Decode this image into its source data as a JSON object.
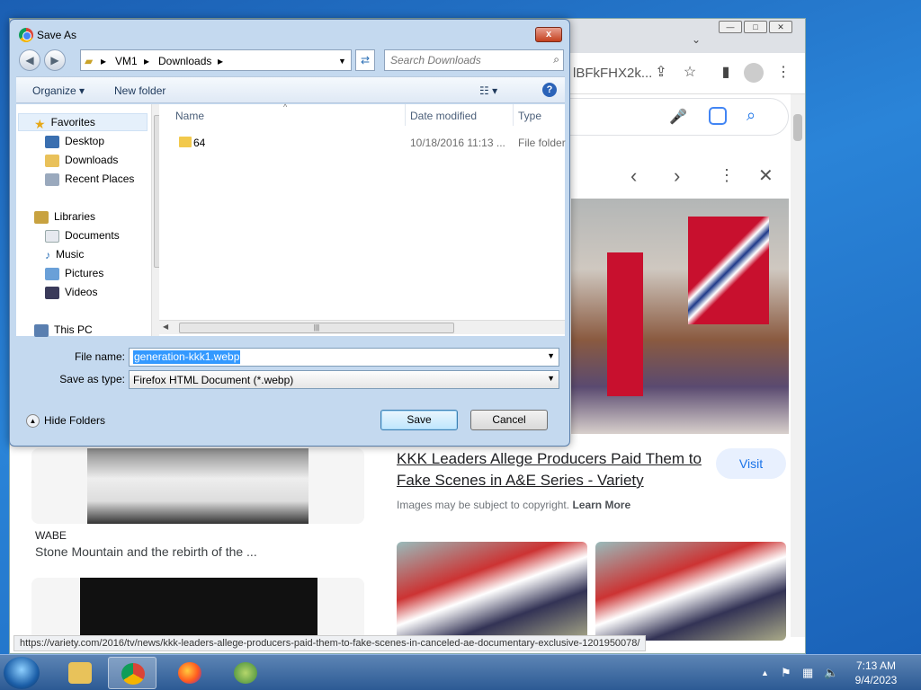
{
  "browser": {
    "url_fragment": "lBFkFHX2k...",
    "panel_caption": "KKK Leaders Allege Producers Paid Them to Fake Scenes in A&E Series - Variety",
    "visit_label": "Visit",
    "copyright_text": "Images may be subject to copyright.",
    "learn_more": "Learn More",
    "left_source": "WABE",
    "left_title": "Stone Mountain and the rebirth of the ...",
    "status_url": "https://variety.com/2016/tv/news/kkk-leaders-allege-producers-paid-them-to-fake-scenes-in-canceled-ae-documentary-exclusive-1201950078/"
  },
  "dialog": {
    "title": "Save As",
    "close_label": "x",
    "breadcrumb": [
      "VM1",
      "Downloads"
    ],
    "search_placeholder": "Search Downloads",
    "organize_label": "Organize",
    "new_folder_label": "New folder",
    "nav": {
      "favorites": "Favorites",
      "items_fav": [
        "Desktop",
        "Downloads",
        "Recent Places"
      ],
      "libraries": "Libraries",
      "items_lib": [
        "Documents",
        "Music",
        "Pictures",
        "Videos"
      ],
      "this_pc": "This PC"
    },
    "columns": {
      "name": "Name",
      "date": "Date modified",
      "type": "Type"
    },
    "files": [
      {
        "name": "64",
        "date": "10/18/2016 11:13 ...",
        "type": "File folder"
      }
    ],
    "file_name_label": "File name:",
    "file_name_value": "generation-kkk1.webp",
    "save_type_label": "Save as type:",
    "save_type_value": "Firefox HTML Document (*.webp)",
    "hide_folders_label": "Hide Folders",
    "save_label": "Save",
    "cancel_label": "Cancel"
  },
  "taskbar": {
    "time": "7:13 AM",
    "date": "9/4/2023"
  }
}
